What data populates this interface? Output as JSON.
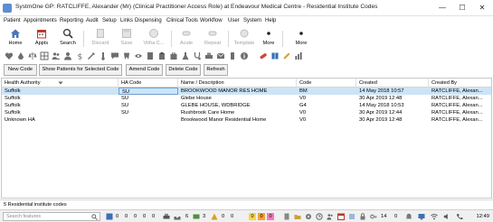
{
  "window": {
    "title": "SystmOne GP: RATCLIFFE, Alexander (Mr) (Clinical Practitioner Access Role) at Endeavour Medical Centre - Residential Institute Codes",
    "minimize": "—",
    "maximize": "☐",
    "close": "✕"
  },
  "menu": [
    "Patient",
    "Appointments",
    "Reporting",
    "Audit",
    "Setup",
    "Links",
    "Dispensing",
    "Clinical Tools",
    "Workflow",
    "User",
    "System",
    "Help"
  ],
  "toolbar": {
    "home": "Home",
    "appts": "Appts",
    "search": "Search",
    "discard": "Discard",
    "save": "Save",
    "vitha": "Vitha C...",
    "acute": "Acute",
    "repeat": "Repeat",
    "template": "Template",
    "more1": "More",
    "more2": "More"
  },
  "buttons": {
    "new_code": "New Code",
    "show_patients": "Show Patients for Selected Code",
    "amend_code": "Amend Code",
    "delete_code": "Delete Code",
    "refresh": "Refresh"
  },
  "table": {
    "headers": {
      "health_authority": "Health Authority",
      "ha_code": "HA Code",
      "name": "Name / Description",
      "code": "Code",
      "created": "Created",
      "created_by": "Created By"
    },
    "rows": [
      {
        "ha": "Suffolk",
        "ha_code": "SU",
        "name": "BROOKWOOD MANOR RES HOME",
        "code": "BM",
        "created": "14 May 2018 10:57",
        "created_by": "RATCLIFFE, Alexan..."
      },
      {
        "ha": "Suffolk",
        "ha_code": "SU",
        "name": "Glebe House",
        "code": "V0",
        "created": "30 Apr 2019 12:48",
        "created_by": "RATCLIFFE, Alexan..."
      },
      {
        "ha": "Suffolk",
        "ha_code": "SU",
        "name": "GLEBE HOUSE, WDBRIDGE",
        "code": "G4",
        "created": "14 May 2018 10:53",
        "created_by": "RATCLIFFE, Alexan..."
      },
      {
        "ha": "Suffolk",
        "ha_code": "SU",
        "name": "Rushbrook Care Home",
        "code": "V0",
        "created": "30 Apr 2019 12:44",
        "created_by": "RATCLIFFE, Alexan..."
      },
      {
        "ha": "Unknown HA",
        "ha_code": "",
        "name": "Brookwood Manor Residential Home",
        "code": "V0",
        "created": "30 Apr 2019 12:48",
        "created_by": "RATCLIFFE, Alexan..."
      }
    ]
  },
  "status": {
    "count_text": "5 Residential institute codes",
    "search_placeholder": "Search features",
    "counters": [
      "0",
      "0",
      "0",
      "0",
      "0",
      "6",
      "3",
      "0",
      "0",
      "0",
      "0",
      "0",
      "14",
      "0"
    ],
    "clock": "12:49"
  },
  "colors": {
    "selected_row": "#cde4f7",
    "badge_yellow": "#f6d74a",
    "badge_orange": "#f2a23b",
    "badge_pink": "#f07cc0"
  }
}
